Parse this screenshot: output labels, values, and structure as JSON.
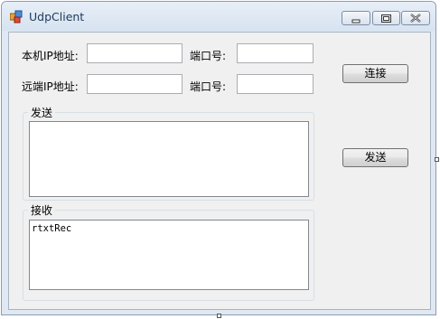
{
  "window": {
    "title": "UdpClient"
  },
  "form": {
    "local_ip_label": "本机IP地址:",
    "local_ip_value": "",
    "local_port_label": "端口号:",
    "local_port_value": "",
    "remote_ip_label": "远端IP地址:",
    "remote_ip_value": "",
    "remote_port_label": "端口号:",
    "remote_port_value": "",
    "connect_button": "连接",
    "send_button": "发送",
    "send_group_title": "发送",
    "send_text": "",
    "receive_group_title": "接收",
    "receive_text": "rtxtRec"
  },
  "icons": {
    "app": "app-icon",
    "minimize": "minimize-icon",
    "maximize": "maximize-icon",
    "close": "close-icon"
  }
}
